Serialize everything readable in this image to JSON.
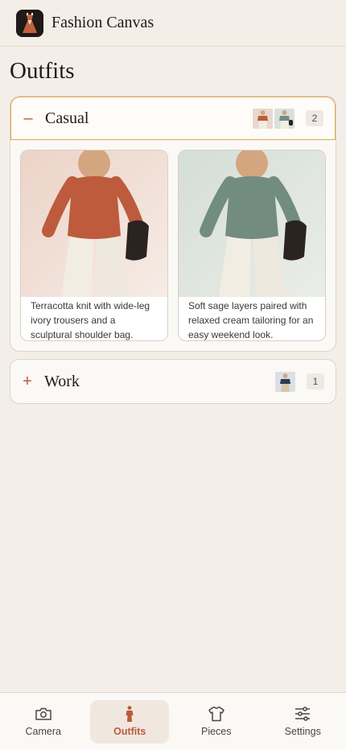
{
  "app": {
    "title": "Fashion Canvas"
  },
  "page": {
    "title": "Outfits"
  },
  "groups": [
    {
      "name": "Casual",
      "expanded": true,
      "toggle": "–",
      "count": "2",
      "outfits": [
        {
          "description": "Terracotta knit with wide-leg ivory trousers and a sculptural shoulder bag.",
          "top_color": "#bd5b3c",
          "bg_color": "#ead7cf"
        },
        {
          "description": "Soft sage layers paired with relaxed cream tailoring for an easy weekend look.",
          "top_color": "#728c81",
          "bg_color": "#d9e0db"
        }
      ]
    },
    {
      "name": "Work",
      "expanded": false,
      "toggle": "+",
      "count": "1",
      "outfits": [
        {
          "top_color": "#2d3c55",
          "bg_color": "#dbe0e6"
        }
      ]
    }
  ],
  "nav": {
    "items": [
      {
        "label": "Camera",
        "icon": "camera-icon"
      },
      {
        "label": "Outfits",
        "icon": "person-icon",
        "active": true
      },
      {
        "label": "Pieces",
        "icon": "tshirt-icon"
      },
      {
        "label": "Settings",
        "icon": "sliders-icon"
      }
    ]
  },
  "colors": {
    "accent": "#b95a3c",
    "background": "#f3eee8",
    "highlight_border": "#d9a851"
  }
}
